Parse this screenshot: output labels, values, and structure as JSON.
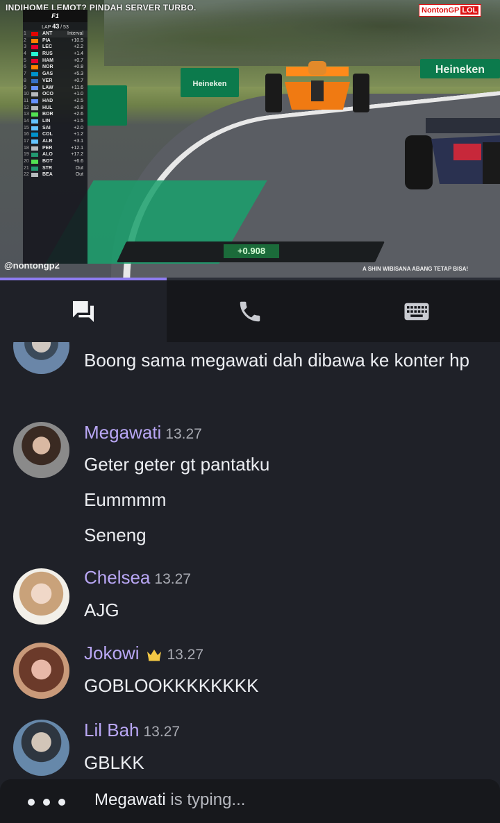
{
  "video": {
    "banner": "INDIHOME LEMOT? PINDAH SERVER TURBO.",
    "logo_main": "NontonGP",
    "logo_badge": "LOL",
    "watermark": "@nontongp2",
    "ticker": "A SHIN WIBISANA ABANG TETAP BISA!",
    "delta": "+0.908",
    "tower": {
      "lap_label": "LAP",
      "lap_current": "43",
      "lap_total": "/ 53",
      "rows": [
        {
          "pos": "1",
          "team": "#e10600",
          "driver": "ANT",
          "gap": "Interval"
        },
        {
          "pos": "2",
          "team": "#ff8000",
          "driver": "PIA",
          "gap": "+10.5"
        },
        {
          "pos": "3",
          "team": "#e8002d",
          "driver": "LEC",
          "gap": "+2.2"
        },
        {
          "pos": "4",
          "team": "#27f4d2",
          "driver": "RUS",
          "gap": "+1.4"
        },
        {
          "pos": "5",
          "team": "#e8002d",
          "driver": "HAM",
          "gap": "+0.7"
        },
        {
          "pos": "6",
          "team": "#ff8000",
          "driver": "NOR",
          "gap": "+0.8"
        },
        {
          "pos": "7",
          "team": "#0093cc",
          "driver": "GAS",
          "gap": "+5.3"
        },
        {
          "pos": "8",
          "team": "#3671c6",
          "driver": "VER",
          "gap": "+0.7"
        },
        {
          "pos": "9",
          "team": "#6692ff",
          "driver": "LAW",
          "gap": "+11.6"
        },
        {
          "pos": "10",
          "team": "#b6babd",
          "driver": "OCO",
          "gap": "+1.0"
        },
        {
          "pos": "11",
          "team": "#6692ff",
          "driver": "HAD",
          "gap": "+2.5"
        },
        {
          "pos": "12",
          "team": "#b6babd",
          "driver": "HUL",
          "gap": "+0.8"
        },
        {
          "pos": "13",
          "team": "#52e252",
          "driver": "BOR",
          "gap": "+2.6"
        },
        {
          "pos": "14",
          "team": "#64c4ff",
          "driver": "LIN",
          "gap": "+1.5"
        },
        {
          "pos": "15",
          "team": "#64c4ff",
          "driver": "SAI",
          "gap": "+2.0"
        },
        {
          "pos": "16",
          "team": "#0093cc",
          "driver": "COL",
          "gap": "+1.2"
        },
        {
          "pos": "17",
          "team": "#64c4ff",
          "driver": "ALB",
          "gap": "+3.1"
        },
        {
          "pos": "18",
          "team": "#b6babd",
          "driver": "PER",
          "gap": "+12.1"
        },
        {
          "pos": "19",
          "team": "#229971",
          "driver": "ALO",
          "gap": "+17.2"
        },
        {
          "pos": "20",
          "team": "#52e252",
          "driver": "BOT",
          "gap": "+6.6"
        },
        {
          "pos": "21",
          "team": "#229971",
          "driver": "STR",
          "gap": "Out"
        },
        {
          "pos": "22",
          "team": "#b6babd",
          "driver": "BEA",
          "gap": "Out"
        }
      ]
    },
    "boards": [
      "Heineken",
      "Heineken",
      "0.0"
    ]
  },
  "progress": 0.333,
  "tabs": [
    {
      "name": "chat-icon",
      "active": true
    },
    {
      "name": "phone-icon",
      "active": false
    },
    {
      "name": "keyboard-icon",
      "active": false
    }
  ],
  "messages": [
    {
      "continuation": true,
      "text": "Boong sama megawati dah dibawa ke konter hp"
    },
    {
      "author": "Megawati",
      "time": "13.27",
      "lines": [
        "Geter geter gt pantatku",
        "Eummmm",
        "Seneng"
      ]
    },
    {
      "author": "Chelsea",
      "time": "13.27",
      "lines": [
        "AJG"
      ]
    },
    {
      "author": "Jokowi",
      "time": "13.27",
      "crown": true,
      "lines": [
        "GOBLOOKKKKKKKK"
      ]
    },
    {
      "author": "Lil Bah",
      "time": "13.27",
      "lines": [
        "GBLKK"
      ]
    }
  ],
  "typing": {
    "who": "Megawati",
    "suffix": " is typing..."
  },
  "colors": {
    "accent": "#8e7cf0",
    "username": "#b9a7f5",
    "background": "#1f2128"
  }
}
